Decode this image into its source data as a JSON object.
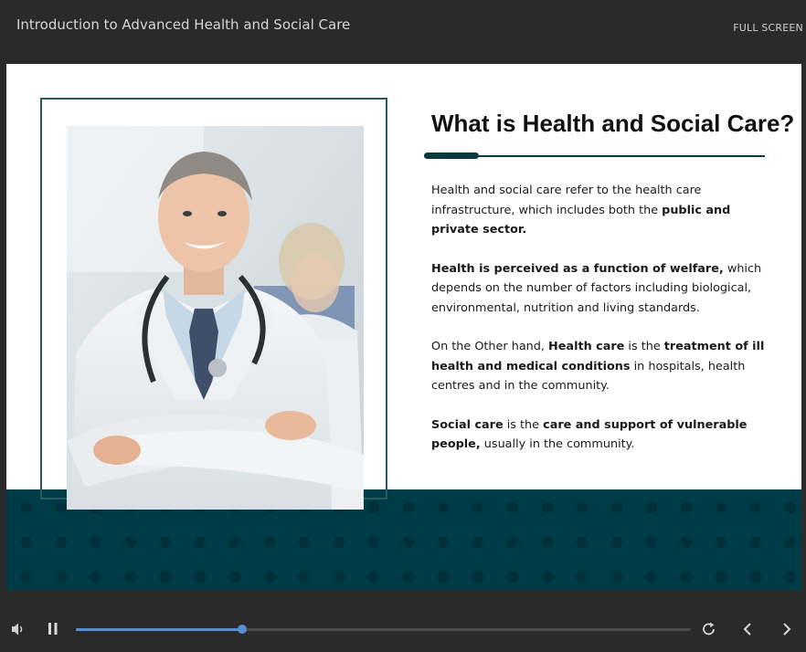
{
  "header": {
    "course_title": "Introduction to Advanced Health and Social Care",
    "fullscreen_label": "FULL SCREEN"
  },
  "slide": {
    "title": "What is Health and Social Care?",
    "image_alt": "Smiling doctor with stethoscope, arms crossed",
    "paragraphs": [
      [
        {
          "t": "Health and social care refer to the health care infrastructure, which includes both the "
        },
        {
          "t": "public and private sector.",
          "b": true
        }
      ],
      [
        {
          "t": "Health is perceived as a function of welfare,",
          "b": true
        },
        {
          "t": " which depends on the number of factors including biological, environmental, nutrition and living standards."
        }
      ],
      [
        {
          "t": "On the Other hand, "
        },
        {
          "t": "Health care",
          "b": true
        },
        {
          "t": " is the "
        },
        {
          "t": "treatment of ill health and medical conditions",
          "b": true
        },
        {
          "t": " in hospitals, health centres and in the community."
        }
      ],
      [
        {
          "t": "Social care",
          "b": true
        },
        {
          "t": " is the "
        },
        {
          "t": "care and support of vulnerable people,",
          "b": true
        },
        {
          "t": " usually in the community."
        }
      ]
    ]
  },
  "player": {
    "progress": 0.27,
    "buffered": 0.17,
    "icons": {
      "volume": "volume-icon",
      "pause": "pause-icon",
      "replay": "replay-icon",
      "prev": "chevron-left-icon",
      "next": "chevron-right-icon"
    },
    "colors": {
      "accent": "#5b8fd3",
      "band": "#003c47",
      "rule": "#083a3d"
    }
  }
}
